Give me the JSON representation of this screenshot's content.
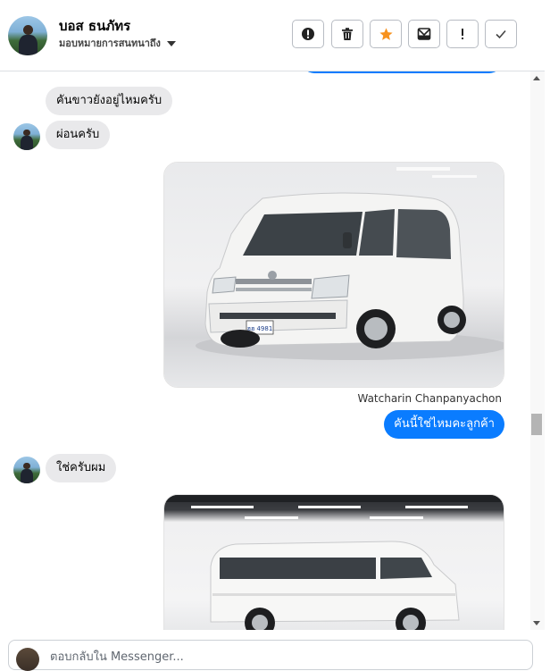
{
  "header": {
    "name": "บอส ธนภัทร",
    "assignee": "มอบหมายการสนทนาถึง",
    "actions": [
      {
        "name": "spam-icon",
        "label": "!"
      },
      {
        "name": "trash-icon",
        "label": ""
      },
      {
        "name": "star-icon",
        "label": "★"
      },
      {
        "name": "archive-icon",
        "label": ""
      },
      {
        "name": "follow-up-icon",
        "label": "!"
      },
      {
        "name": "done-check-icon",
        "label": "✓"
      }
    ]
  },
  "messages": [
    {
      "id": 1,
      "direction": "in",
      "text": "คันขาวยังอยู่ไหมครับ"
    },
    {
      "id": 2,
      "direction": "in",
      "text": "ผ่อนครับ"
    },
    {
      "id": 3,
      "direction": "out",
      "type": "photo",
      "subject": "white-van-front"
    },
    {
      "id": 4,
      "direction": "out",
      "sender": "Watcharin Chanpanyachon",
      "text": "คันนี้ใช่ไหมคะลูกค้า"
    },
    {
      "id": 5,
      "direction": "in",
      "text": "ใช่ครับผม"
    },
    {
      "id": 6,
      "direction": "out",
      "type": "photo",
      "subject": "white-van-side"
    }
  ],
  "plate_text": "ฮฮ 4981",
  "composer": {
    "placeholder": "ตอบกลับใน Messenger..."
  },
  "colors": {
    "outgoing": "#0a7cff",
    "incoming": "#e9e9eb",
    "star": "#f7921e"
  }
}
